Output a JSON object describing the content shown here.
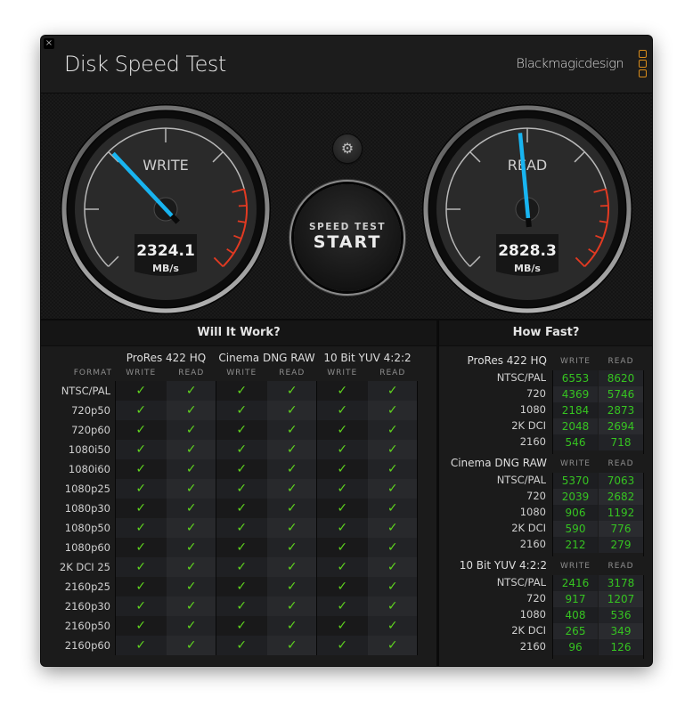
{
  "window": {
    "close_icon": "×",
    "title": "Disk Speed Test",
    "brand": "Blackmagicdesign"
  },
  "gauges": {
    "write": {
      "label": "WRITE",
      "value": "2324.1",
      "unit": "MB/s",
      "needle_fraction": 0.34
    },
    "read": {
      "label": "READ",
      "value": "2828.3",
      "unit": "MB/s",
      "needle_fraction": 0.48
    }
  },
  "controls": {
    "settings_icon": "⚙",
    "start_small": "SPEED TEST",
    "start_big": "START"
  },
  "will_it_work": {
    "title": "Will It Work?",
    "format_header": "FORMAT",
    "check_icon": "✓",
    "groups": [
      {
        "name": "ProRes 422 HQ",
        "cols": [
          "WRITE",
          "READ"
        ]
      },
      {
        "name": "Cinema DNG RAW",
        "cols": [
          "WRITE",
          "READ"
        ]
      },
      {
        "name": "10 Bit YUV 4:2:2",
        "cols": [
          "WRITE",
          "READ"
        ]
      }
    ],
    "rows": [
      {
        "format": "NTSC/PAL",
        "checks": [
          true,
          true,
          true,
          true,
          true,
          true
        ]
      },
      {
        "format": "720p50",
        "checks": [
          true,
          true,
          true,
          true,
          true,
          true
        ]
      },
      {
        "format": "720p60",
        "checks": [
          true,
          true,
          true,
          true,
          true,
          true
        ]
      },
      {
        "format": "1080i50",
        "checks": [
          true,
          true,
          true,
          true,
          true,
          true
        ]
      },
      {
        "format": "1080i60",
        "checks": [
          true,
          true,
          true,
          true,
          true,
          true
        ]
      },
      {
        "format": "1080p25",
        "checks": [
          true,
          true,
          true,
          true,
          true,
          true
        ]
      },
      {
        "format": "1080p30",
        "checks": [
          true,
          true,
          true,
          true,
          true,
          true
        ]
      },
      {
        "format": "1080p50",
        "checks": [
          true,
          true,
          true,
          true,
          true,
          true
        ]
      },
      {
        "format": "1080p60",
        "checks": [
          true,
          true,
          true,
          true,
          true,
          true
        ]
      },
      {
        "format": "2K DCI 25",
        "checks": [
          true,
          true,
          true,
          true,
          true,
          true
        ]
      },
      {
        "format": "2160p25",
        "checks": [
          true,
          true,
          true,
          true,
          true,
          true
        ]
      },
      {
        "format": "2160p30",
        "checks": [
          true,
          true,
          true,
          true,
          true,
          true
        ]
      },
      {
        "format": "2160p50",
        "checks": [
          true,
          true,
          true,
          true,
          true,
          true
        ]
      },
      {
        "format": "2160p60",
        "checks": [
          true,
          true,
          true,
          true,
          true,
          true
        ]
      }
    ]
  },
  "how_fast": {
    "title": "How Fast?",
    "write_header": "WRITE",
    "read_header": "READ",
    "groups": [
      {
        "name": "ProRes 422 HQ",
        "rows": [
          {
            "label": "NTSC/PAL",
            "write": "6553",
            "read": "8620"
          },
          {
            "label": "720",
            "write": "4369",
            "read": "5746"
          },
          {
            "label": "1080",
            "write": "2184",
            "read": "2873"
          },
          {
            "label": "2K DCI",
            "write": "2048",
            "read": "2694"
          },
          {
            "label": "2160",
            "write": "546",
            "read": "718"
          }
        ]
      },
      {
        "name": "Cinema DNG RAW",
        "rows": [
          {
            "label": "NTSC/PAL",
            "write": "5370",
            "read": "7063"
          },
          {
            "label": "720",
            "write": "2039",
            "read": "2682"
          },
          {
            "label": "1080",
            "write": "906",
            "read": "1192"
          },
          {
            "label": "2K DCI",
            "write": "590",
            "read": "776"
          },
          {
            "label": "2160",
            "write": "212",
            "read": "279"
          }
        ]
      },
      {
        "name": "10 Bit YUV 4:2:2",
        "rows": [
          {
            "label": "NTSC/PAL",
            "write": "2416",
            "read": "3178"
          },
          {
            "label": "720",
            "write": "917",
            "read": "1207"
          },
          {
            "label": "1080",
            "write": "408",
            "read": "536"
          },
          {
            "label": "2K DCI",
            "write": "265",
            "read": "349"
          },
          {
            "label": "2160",
            "write": "96",
            "read": "126"
          }
        ]
      }
    ]
  },
  "colors": {
    "needle": "#18b4f0",
    "redline": "#e23a22",
    "check": "#5fd31f",
    "speed_value": "#36c421",
    "brand_logo": "#d98c1a"
  }
}
